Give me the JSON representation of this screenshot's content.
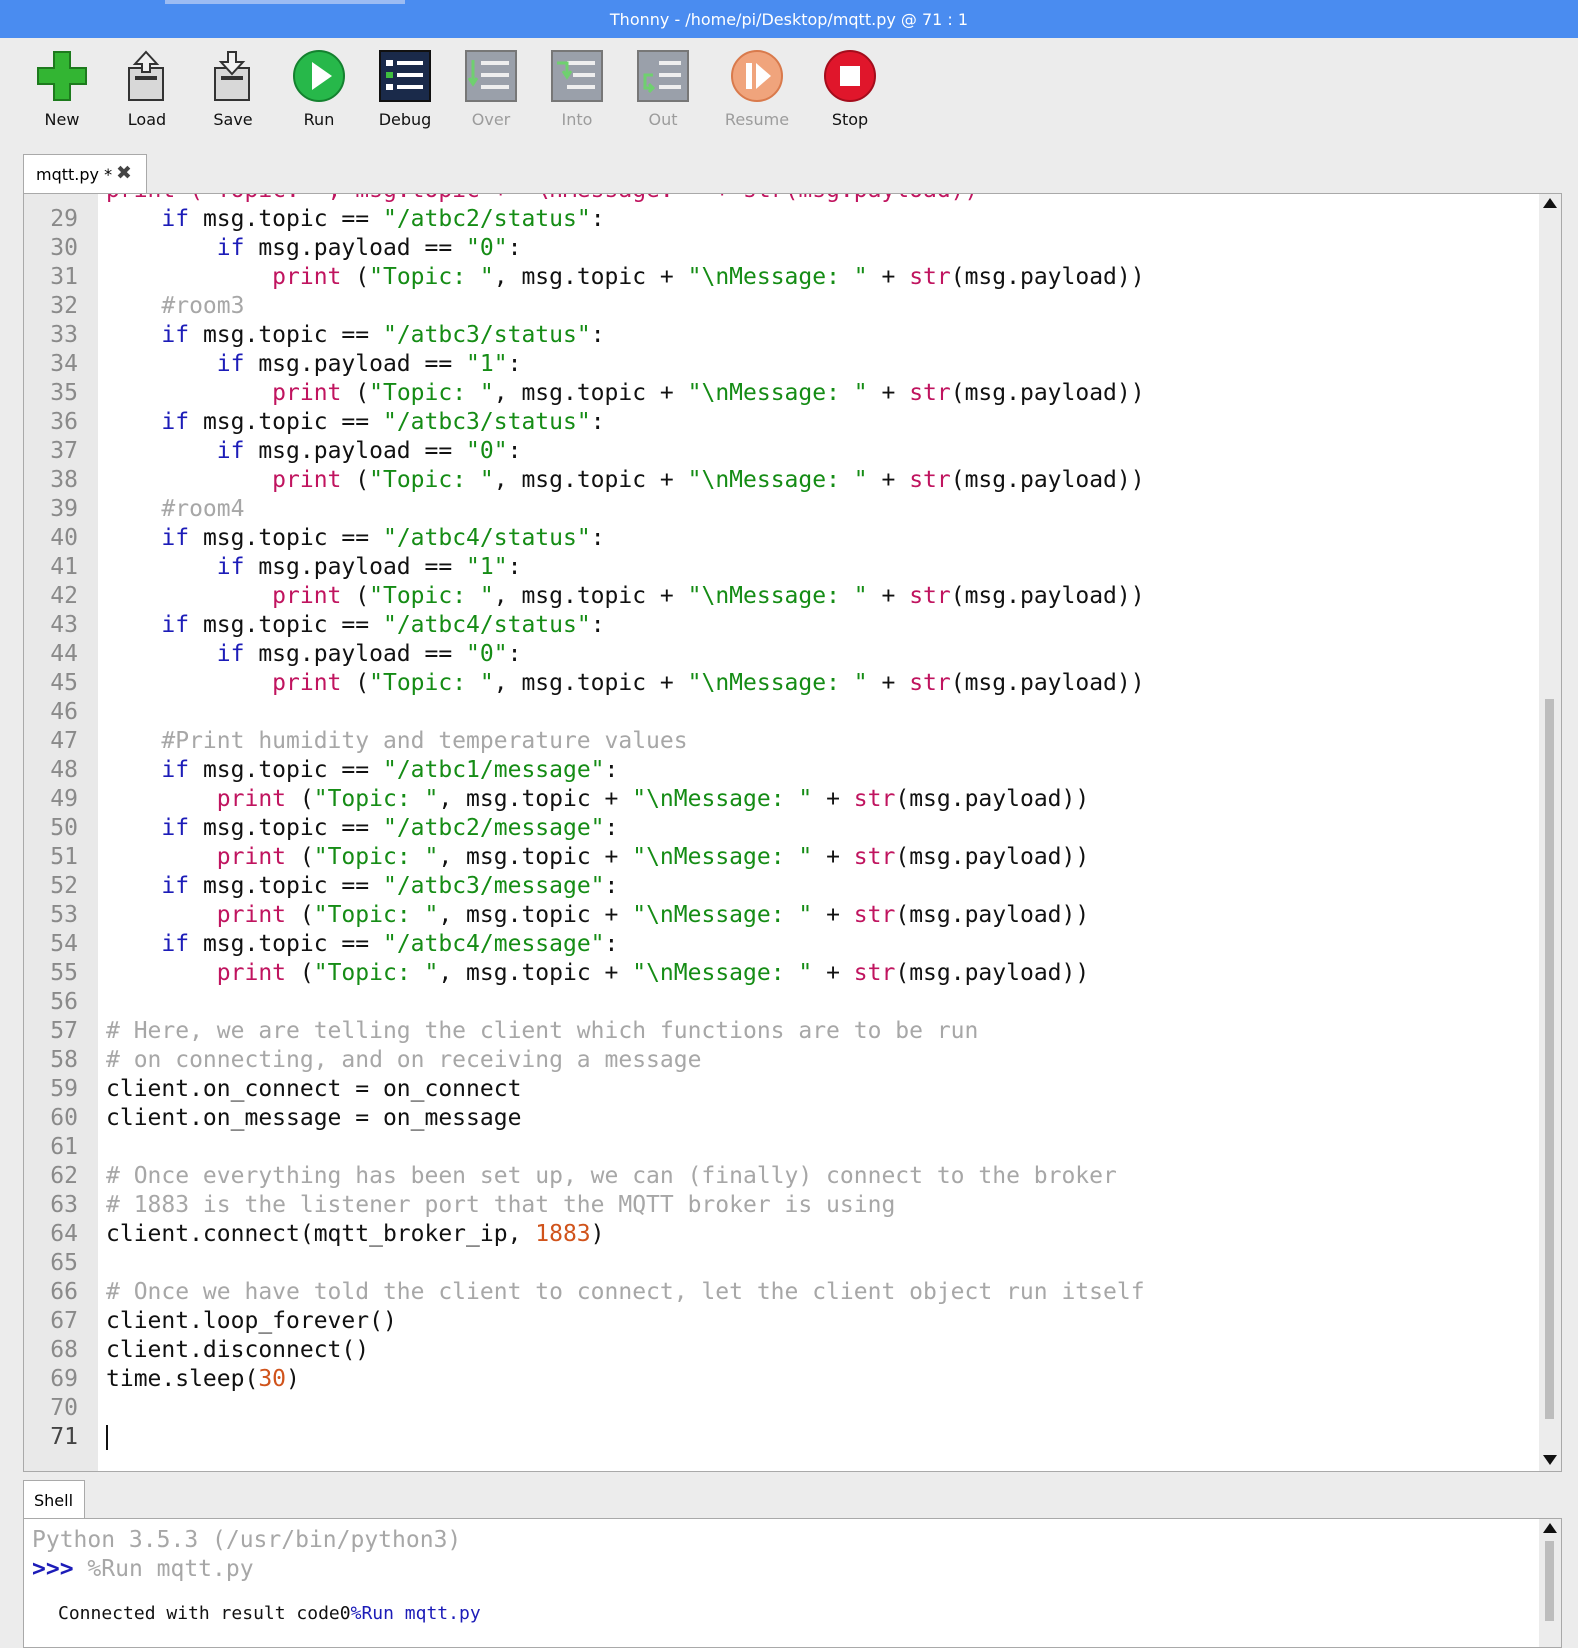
{
  "window": {
    "title": "Thonny  -  /home/pi/Desktop/mqtt.py  @  71 : 1"
  },
  "toolbar": {
    "new": "New",
    "load": "Load",
    "save": "Save",
    "run": "Run",
    "debug": "Debug",
    "over": "Over",
    "into": "Into",
    "out": "Out",
    "resume": "Resume",
    "stop": "Stop"
  },
  "colors": {
    "titlebar": "#4a8cf0",
    "keyword": "#1c1cb8",
    "string": "#158c15",
    "comment": "#a7a7a7",
    "number": "#d0531b",
    "builtin": "#c0145f"
  },
  "editor": {
    "tab_label": "mqtt.py *",
    "partial_top_line": "print (\"Topic: \", msg.topic + \"\\nMessage: \" + str(msg.payload))",
    "line_numbers": [
      "29",
      "30",
      "31",
      "32",
      "33",
      "34",
      "35",
      "36",
      "37",
      "38",
      "39",
      "40",
      "41",
      "42",
      "43",
      "44",
      "45",
      "46",
      "47",
      "48",
      "49",
      "50",
      "51",
      "52",
      "53",
      "54",
      "55",
      "56",
      "57",
      "58",
      "59",
      "60",
      "61",
      "62",
      "63",
      "64",
      "65",
      "66",
      "67",
      "68",
      "69",
      "70",
      "71"
    ]
  },
  "shell": {
    "tab_label": "Shell",
    "python_version": "Python 3.5.3 (/usr/bin/python3)",
    "prompt": ">>>",
    "command": "%Run mqtt.py",
    "output_text": "Connected with result code0",
    "output_cmd": "%Run mqtt.py"
  }
}
